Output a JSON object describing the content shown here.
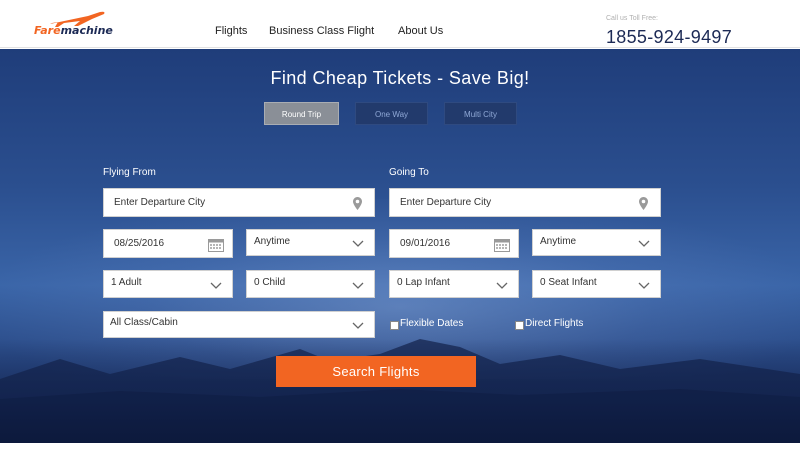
{
  "header": {
    "logo": {
      "part1": "Fare",
      "part2": "machine"
    },
    "nav": [
      {
        "label": "Flights"
      },
      {
        "label": "Business Class Flight"
      },
      {
        "label": "About Us"
      }
    ],
    "toll_free_label": "Call us Toll Free:",
    "toll_free_number": "1855-924-9497"
  },
  "hero": {
    "title": "Find Cheap Tickets - Save Big!",
    "trip_types": [
      {
        "label": "Round Trip",
        "active": true
      },
      {
        "label": "One Way",
        "active": false
      },
      {
        "label": "Multi City",
        "active": false
      }
    ]
  },
  "form": {
    "from_label": "Flying From",
    "to_label": "Going To",
    "from_placeholder": "Enter Departure City",
    "to_placeholder": "Enter Departure City",
    "depart_date": "08/25/2016",
    "depart_time": "Anytime",
    "return_date": "09/01/2016",
    "return_time": "Anytime",
    "adults": "1 Adult",
    "children": "0 Child",
    "lap_infant": "0 Lap Infant",
    "seat_infant": "0 Seat Infant",
    "cabin": "All Class/Cabin",
    "flexible_dates": "Flexible Dates",
    "direct_flights": "Direct Flights",
    "search_button": "Search Flights"
  },
  "colors": {
    "accent": "#f26522",
    "brand_dark": "#1c2a55",
    "hero_blue": "#2b4f8f"
  },
  "icons": {
    "location": "map-pin-icon",
    "calendar": "calendar-icon",
    "dropdown": "chevron-down-icon",
    "logo": "airplane-icon"
  }
}
